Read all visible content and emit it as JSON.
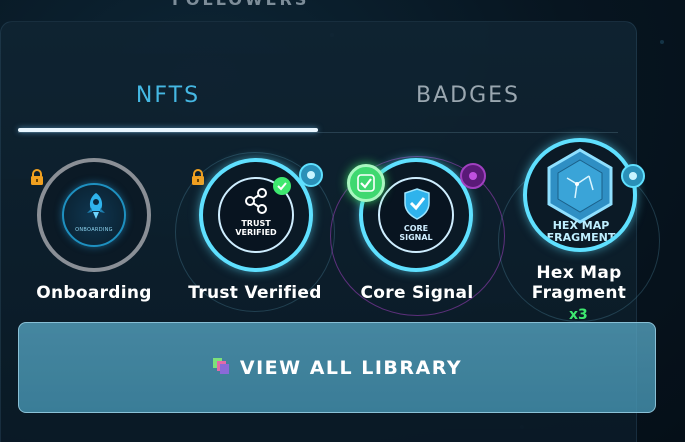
{
  "header": {
    "partial_label": "FOLLOWERS"
  },
  "tabs": [
    {
      "label": "NFTS",
      "active": true
    },
    {
      "label": "BADGES",
      "active": false
    }
  ],
  "nfts": [
    {
      "name": "Onboarding",
      "icon": "rocket-icon",
      "emblem_text": "ONBOARDING",
      "locked": true,
      "state": "locked"
    },
    {
      "name": "Trust Verified",
      "icon": "share-nodes-icon",
      "emblem_text": "TRUST VERIFIED",
      "locked": true,
      "state": "verified"
    },
    {
      "name": "Core Signal",
      "icon": "shield-check-icon",
      "emblem_text": "CORE SIGNAL",
      "locked": false,
      "state": "selected"
    },
    {
      "name": "Hex Map Fragment",
      "icon": "hex-map-icon",
      "emblem_text": "HEX MAP FRAGMENT",
      "locked": false,
      "count": "x3"
    }
  ],
  "view_all": {
    "label": "VIEW ALL LIBRARY",
    "icon": "library-icon"
  },
  "colors": {
    "accent": "#45b8e3",
    "ring_cyan": "#5fe0ff",
    "lock": "#f0a020",
    "check_green": "#3ee86f",
    "purple": "#a040c0"
  }
}
